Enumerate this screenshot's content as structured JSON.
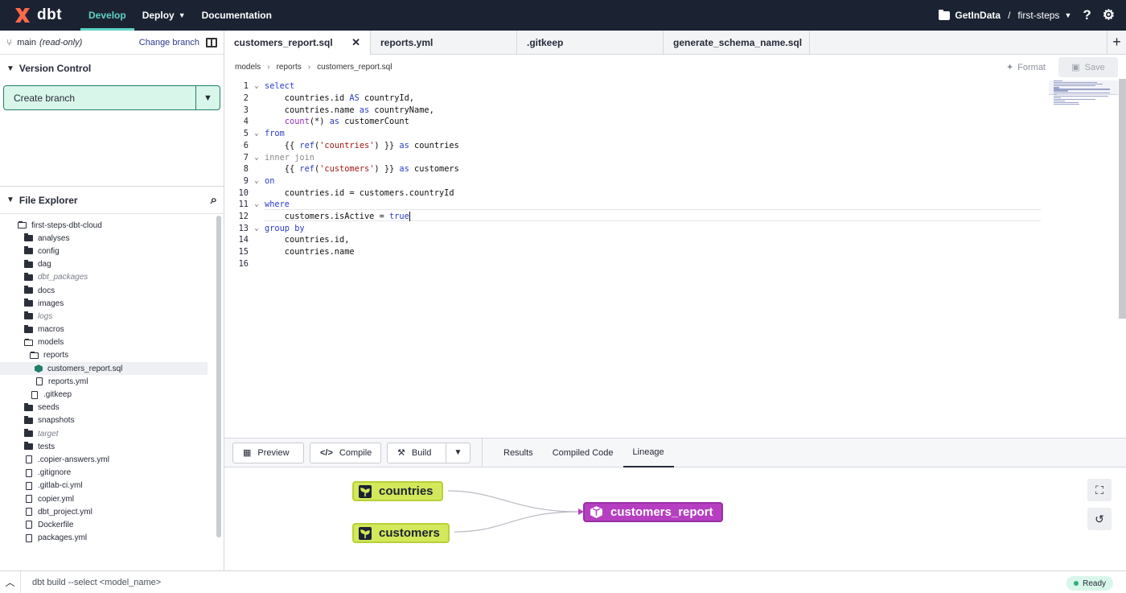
{
  "nav": {
    "logo_text": "dbt",
    "tabs": [
      {
        "label": "Develop",
        "active": true
      },
      {
        "label": "Deploy",
        "dropdown": true
      },
      {
        "label": "Documentation"
      }
    ],
    "project": "GetInData",
    "separator": "/",
    "environment": "first-steps",
    "help_icon": "question-icon",
    "settings_icon": "gear-icon"
  },
  "sidebar": {
    "branch": "main",
    "branch_status": "(read-only)",
    "change_branch_label": "Change branch",
    "version_control_title": "Version Control",
    "create_branch_label": "Create branch",
    "file_explorer_title": "File Explorer",
    "tree": [
      {
        "label": "first-steps-dbt-cloud",
        "type": "folder-open",
        "indent": 0
      },
      {
        "label": "analyses",
        "type": "folder",
        "indent": 1
      },
      {
        "label": "config",
        "type": "folder",
        "indent": 1
      },
      {
        "label": "dag",
        "type": "folder",
        "indent": 1
      },
      {
        "label": "dbt_packages",
        "type": "folder",
        "indent": 1,
        "italic": true
      },
      {
        "label": "docs",
        "type": "folder",
        "indent": 1
      },
      {
        "label": "images",
        "type": "folder",
        "indent": 1
      },
      {
        "label": "logs",
        "type": "folder",
        "indent": 1,
        "italic": true
      },
      {
        "label": "macros",
        "type": "folder",
        "indent": 1
      },
      {
        "label": "models",
        "type": "folder-open",
        "indent": 1
      },
      {
        "label": "reports",
        "type": "folder-open",
        "indent": 2
      },
      {
        "label": "customers_report.sql",
        "type": "model",
        "indent": 3,
        "selected": true
      },
      {
        "label": "reports.yml",
        "type": "file",
        "indent": 3
      },
      {
        "label": ".gitkeep",
        "type": "file",
        "indent": 2
      },
      {
        "label": "seeds",
        "type": "folder",
        "indent": 1
      },
      {
        "label": "snapshots",
        "type": "folder",
        "indent": 1
      },
      {
        "label": "target",
        "type": "folder",
        "indent": 1,
        "italic": true
      },
      {
        "label": "tests",
        "type": "folder",
        "indent": 1
      },
      {
        "label": ".copier-answers.yml",
        "type": "file",
        "indent": 1
      },
      {
        "label": ".gitignore",
        "type": "file",
        "indent": 1
      },
      {
        "label": ".gitlab-ci.yml",
        "type": "file",
        "indent": 1
      },
      {
        "label": "copier.yml",
        "type": "file",
        "indent": 1
      },
      {
        "label": "dbt_project.yml",
        "type": "file",
        "indent": 1
      },
      {
        "label": "Dockerfile",
        "type": "file",
        "indent": 1
      },
      {
        "label": "packages.yml",
        "type": "file",
        "indent": 1
      }
    ]
  },
  "editor_tabs": [
    {
      "label": "customers_report.sql",
      "active": true,
      "closable": true
    },
    {
      "label": "reports.yml"
    },
    {
      "label": ".gitkeep"
    },
    {
      "label": "generate_schema_name.sql"
    }
  ],
  "breadcrumb": [
    "models",
    "reports",
    "customers_report.sql"
  ],
  "actions": {
    "format_label": "Format",
    "save_label": "Save"
  },
  "code_lines": [
    {
      "num": "1",
      "fold": true,
      "tokens": [
        {
          "t": "select",
          "c": "kw"
        }
      ]
    },
    {
      "num": "2",
      "tokens": [
        {
          "t": "    countries.id "
        },
        {
          "t": "AS",
          "c": "kw"
        },
        {
          "t": " countryId,"
        }
      ]
    },
    {
      "num": "3",
      "tokens": [
        {
          "t": "    countries.name "
        },
        {
          "t": "as",
          "c": "kw"
        },
        {
          "t": " countryName,"
        }
      ]
    },
    {
      "num": "4",
      "tokens": [
        {
          "t": "    "
        },
        {
          "t": "count",
          "c": "fn"
        },
        {
          "t": "(*) "
        },
        {
          "t": "as",
          "c": "kw"
        },
        {
          "t": " customerCount"
        }
      ]
    },
    {
      "num": "5",
      "fold": true,
      "tokens": [
        {
          "t": "from",
          "c": "kw"
        }
      ]
    },
    {
      "num": "6",
      "tokens": [
        {
          "t": "    {{ "
        },
        {
          "t": "ref",
          "c": "kw"
        },
        {
          "t": "("
        },
        {
          "t": "'countries'",
          "c": "str"
        },
        {
          "t": ") }} "
        },
        {
          "t": "as",
          "c": "kw"
        },
        {
          "t": " countries"
        }
      ]
    },
    {
      "num": "7",
      "fold": true,
      "tokens": [
        {
          "t": "inner join",
          "c": "dim"
        }
      ]
    },
    {
      "num": "8",
      "tokens": [
        {
          "t": "    {{ "
        },
        {
          "t": "ref",
          "c": "kw"
        },
        {
          "t": "("
        },
        {
          "t": "'customers'",
          "c": "str"
        },
        {
          "t": ") }} "
        },
        {
          "t": "as",
          "c": "kw"
        },
        {
          "t": " customers"
        }
      ]
    },
    {
      "num": "9",
      "fold": true,
      "tokens": [
        {
          "t": "on",
          "c": "kw"
        }
      ]
    },
    {
      "num": "10",
      "tokens": [
        {
          "t": "    countries.id = customers.countryId"
        }
      ]
    },
    {
      "num": "11",
      "fold": true,
      "tokens": [
        {
          "t": "where",
          "c": "kw"
        }
      ]
    },
    {
      "num": "12",
      "tokens": [
        {
          "t": "    customers.isActive = "
        },
        {
          "t": "true",
          "c": "kw"
        }
      ],
      "cursor": true
    },
    {
      "num": "13",
      "fold": true,
      "tokens": [
        {
          "t": "group by",
          "c": "kw"
        }
      ]
    },
    {
      "num": "14",
      "tokens": [
        {
          "t": "    countries.id,"
        }
      ]
    },
    {
      "num": "15",
      "tokens": [
        {
          "t": "    countries.name"
        }
      ]
    },
    {
      "num": "16",
      "tokens": []
    }
  ],
  "bottom": {
    "preview_label": "Preview",
    "compile_label": "Compile",
    "build_label": "Build",
    "result_tabs": [
      {
        "label": "Results"
      },
      {
        "label": "Compiled Code"
      },
      {
        "label": "Lineage",
        "active": true
      }
    ],
    "lineage": {
      "sources": [
        "countries",
        "customers"
      ],
      "model": "customers_report"
    }
  },
  "command_bar": {
    "placeholder": "dbt build --select <model_name>",
    "status": "Ready"
  }
}
